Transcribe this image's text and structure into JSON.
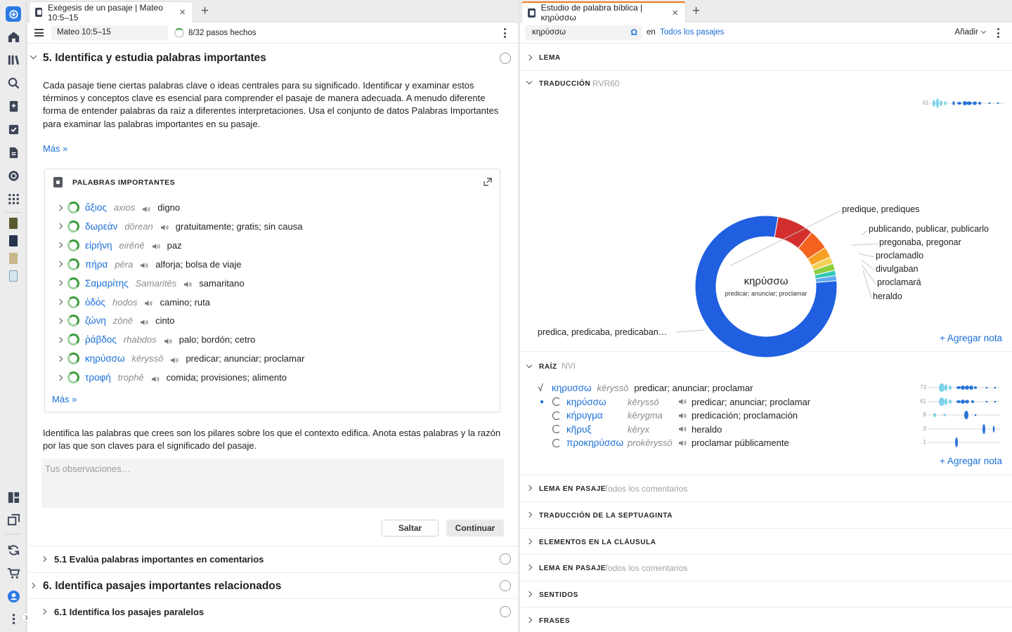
{
  "left_panel": {
    "tab_title": "Exégesis de un pasaje | Mateo 10:5–15",
    "reference": "Mateo 10:5–15",
    "progress": "8/32 pasos hechos",
    "progress_fraction": 0.25,
    "step5": {
      "title": "5. Identifica y estudia palabras importantes",
      "description": "Cada pasaje tiene ciertas palabras clave o ideas centrales para su significado. Identificar y examinar estos términos y conceptos clave es esencial para comprender el pasaje de manera adecuada. A menudo diferente forma de entender palabras da raíz a diferentes interpretaciones. Usa el conjunto de datos Palabras Importantes para examinar las palabras importantes en su pasaje.",
      "more": "Más »"
    },
    "card": {
      "title": "PALABRAS IMPORTANTES",
      "more": "Más »",
      "words": [
        {
          "greek": "ἄξιος",
          "translit": "axios",
          "gloss": "digno"
        },
        {
          "greek": "δωρεάν",
          "translit": "dōrean",
          "gloss": "gratuitamente; gratis; sin causa"
        },
        {
          "greek": "εἰρήνη",
          "translit": "eirēnē",
          "gloss": "paz"
        },
        {
          "greek": "πήρα",
          "translit": "pēra",
          "gloss": "alforja; bolsa de viaje"
        },
        {
          "greek": "Σαμαρίτης",
          "translit": "Samaritēs",
          "gloss": "samaritano"
        },
        {
          "greek": "ὁδός",
          "translit": "hodos",
          "gloss": "camino; ruta"
        },
        {
          "greek": "ζώνη",
          "translit": "zōnē",
          "gloss": "cinto"
        },
        {
          "greek": "ῥάβδος",
          "translit": "rhabdos",
          "gloss": "palo; bordón; cetro"
        },
        {
          "greek": "κηρύσσω",
          "translit": "kēryssō",
          "gloss": "predicar; anunciar; proclamar"
        },
        {
          "greek": "τροφή",
          "translit": "trophē",
          "gloss": "comida; provisiones; alimento"
        }
      ]
    },
    "prompt": "Identifica las palabras que crees son los pilares sobre los que el contexto edifica. Anota estas palabras y la razón por las que son claves para el significado del pasaje.",
    "observations_placeholder": "Tus observaciones…",
    "skip_label": "Saltar",
    "continue_label": "Continuar",
    "steps": [
      {
        "title": "5.1 Evalúa palabras importantes en comentarios"
      },
      {
        "title": "6. Identifica pasajes importantes relacionados"
      },
      {
        "title": "6.1 Identifica los pasajes paralelos"
      }
    ]
  },
  "right_panel": {
    "tab_title": "Estudio de palabra bíblica | κηρύσσω",
    "search_value": "κηρύσσω",
    "omega": "Ω",
    "in_label": "en",
    "scope": "Todos los pasajes",
    "add_menu": "Añadir",
    "sections": {
      "lema": "LEMA",
      "traduccion": "TRADUCCIÓN",
      "traduccion_version": "RVR60",
      "raiz": "RAÍZ",
      "raiz_version": "NVI",
      "lema_pasaje": "LEMA EN PASAJE",
      "todos_comentarios": "Todos los comentarios",
      "septuaginta": "TRADUCCIÓN DE LA SEPTUAGINTA",
      "clausula": "ELEMENTOS EN LA CLÁUSULA",
      "lema_pasaje_2": "LEMA EN PASAJE",
      "todos_comentarios_2": "Todos los comentarios",
      "sentidos": "SENTIDOS",
      "frases": "FRASES"
    },
    "add_note": "+ Agregar nota",
    "add_note_2": "+ Agregar nota",
    "translation_count": "61",
    "chart_data": {
      "type": "pie",
      "center_title": "κηρύσσω",
      "center_subtitle": "predicar; anunciar; proclamar",
      "slices": [
        {
          "label": "predica, predicaba, predicaban…",
          "value": 0.79,
          "color": "#1f5fe0"
        },
        {
          "label": "predique, prediques",
          "value": 0.084,
          "color": "#d32f2f"
        },
        {
          "label": "publicando, publicar, publicarlo",
          "value": 0.046,
          "color": "#f4621f"
        },
        {
          "label": "pregonaba, pregonar",
          "value": 0.024,
          "color": "#f7a021"
        },
        {
          "label": "proclamadlo",
          "value": 0.016,
          "color": "#f3d25a"
        },
        {
          "label": "divulgaban",
          "value": 0.016,
          "color": "#8ccf3f"
        },
        {
          "label": "proclamará",
          "value": 0.012,
          "color": "#34c6b7"
        },
        {
          "label": "heraldo",
          "value": 0.012,
          "color": "#60a8f0"
        }
      ]
    },
    "root": {
      "main": {
        "greek": "κηρυσσω",
        "translit": "kēryssō",
        "gloss": "predicar; anunciar; proclamar",
        "count": "73"
      },
      "words": [
        {
          "greek": "κηρύσσω",
          "translit": "kēryssō",
          "gloss": "predicar; anunciar; proclamar",
          "count": "61"
        },
        {
          "greek": "κήρυγμα",
          "translit": "kērygma",
          "gloss": "predicación; proclamación",
          "count": "8"
        },
        {
          "greek": "κῆρυξ",
          "translit": "kēryx",
          "gloss": "heraldo",
          "count": "3"
        },
        {
          "greek": "προκηρύσσω",
          "translit": "prokēryssō",
          "gloss": "proclamar públicamente",
          "count": "1"
        }
      ]
    }
  }
}
